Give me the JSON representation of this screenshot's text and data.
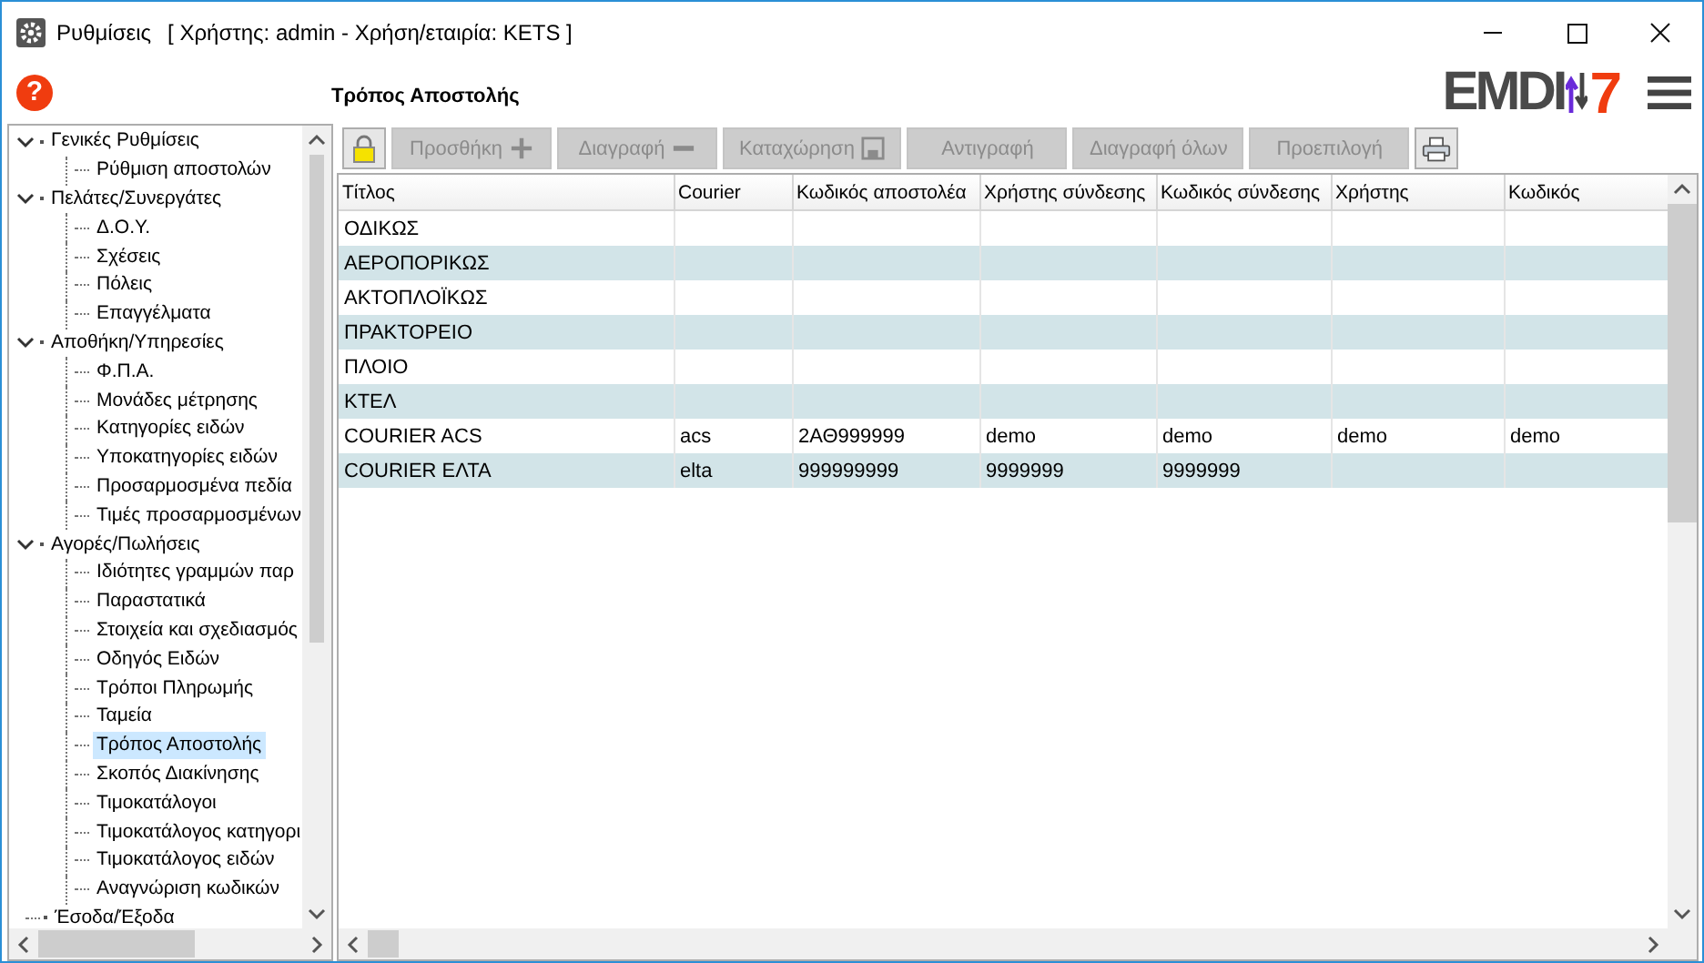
{
  "window": {
    "title": "Ρυθμίσεις",
    "subtitle": "[ Χρήστης: admin - Χρήση/εταιρία: KETS ]"
  },
  "header": {
    "help": "?",
    "page_title": "Τρόπος Αποστολής",
    "logo": {
      "text": "EMDI",
      "suffix": "7"
    }
  },
  "tree": [
    {
      "label": "Γενικές Ρυθμίσεις",
      "expanded": true,
      "children": [
        {
          "label": "Ρύθμιση αποστολών",
          "selected": false
        }
      ]
    },
    {
      "label": "Πελάτες/Συνεργάτες",
      "expanded": true,
      "children": [
        {
          "label": "Δ.Ο.Υ.",
          "selected": false
        },
        {
          "label": "Σχέσεις",
          "selected": false
        },
        {
          "label": "Πόλεις",
          "selected": false
        },
        {
          "label": "Επαγγέλματα",
          "selected": false
        }
      ]
    },
    {
      "label": "Αποθήκη/Υπηρεσίες",
      "expanded": true,
      "children": [
        {
          "label": "Φ.Π.Α.",
          "selected": false
        },
        {
          "label": "Μονάδες μέτρησης",
          "selected": false
        },
        {
          "label": "Κατηγορίες ειδών",
          "selected": false
        },
        {
          "label": "Υποκατηγορίες ειδών",
          "selected": false
        },
        {
          "label": "Προσαρμοσμένα πεδία",
          "selected": false
        },
        {
          "label": "Τιμές προσαρμοσμένων",
          "selected": false
        }
      ]
    },
    {
      "label": "Αγορές/Πωλήσεις",
      "expanded": true,
      "children": [
        {
          "label": "Ιδιότητες γραμμών παρ",
          "selected": false
        },
        {
          "label": "Παραστατικά",
          "selected": false
        },
        {
          "label": "Στοιχεία και σχεδιασμός",
          "selected": false
        },
        {
          "label": "Οδηγός Ειδών",
          "selected": false
        },
        {
          "label": "Τρόποι Πληρωμής",
          "selected": false
        },
        {
          "label": "Ταμεία",
          "selected": false
        },
        {
          "label": "Τρόπος Αποστολής",
          "selected": true
        },
        {
          "label": "Σκοπός Διακίνησης",
          "selected": false
        },
        {
          "label": "Τιμοκατάλογοι",
          "selected": false
        },
        {
          "label": "Τιμοκατάλογος κατηγορι",
          "selected": false
        },
        {
          "label": "Τιμοκατάλογος ειδών",
          "selected": false
        },
        {
          "label": "Αναγνώριση κωδικών",
          "selected": false
        }
      ]
    },
    {
      "label": "Έσοδα/Έξοδα",
      "selected": false
    }
  ],
  "toolbar": [
    {
      "kind": "lock",
      "disabled": false
    },
    {
      "kind": "add",
      "label": "Προσθήκη",
      "disabled": true
    },
    {
      "kind": "remove",
      "label": "Διαγραφή",
      "disabled": true
    },
    {
      "kind": "save",
      "label": "Καταχώρηση",
      "disabled": true
    },
    {
      "kind": "text",
      "label": "Αντιγραφή",
      "disabled": true
    },
    {
      "kind": "text",
      "label": "Διαγραφή όλων",
      "disabled": true
    },
    {
      "kind": "text",
      "label": "Προεπιλογή",
      "disabled": true
    },
    {
      "kind": "print",
      "disabled": false
    }
  ],
  "table": {
    "columns": [
      "Τίτλος",
      "Courier",
      "Κωδικός αποστολέα",
      "Χρήστης σύνδεσης",
      "Κωδικός σύνδεσης",
      "Χρήστης",
      "Κωδικός"
    ],
    "rows": [
      [
        "ΟΔΙΚΩΣ",
        "",
        "",
        "",
        "",
        "",
        ""
      ],
      [
        "ΑΕΡΟΠΟΡΙΚΩΣ",
        "",
        "",
        "",
        "",
        "",
        ""
      ],
      [
        "ΑΚΤΟΠΛΟΪΚΩΣ",
        "",
        "",
        "",
        "",
        "",
        ""
      ],
      [
        "ΠΡΑΚΤΟΡΕΙΟ",
        "",
        "",
        "",
        "",
        "",
        ""
      ],
      [
        "ΠΛΟΙΟ",
        "",
        "",
        "",
        "",
        "",
        ""
      ],
      [
        "ΚΤΕΛ",
        "",
        "",
        "",
        "",
        "",
        ""
      ],
      [
        "COURIER ACS",
        "acs",
        "2ΑΘ999999",
        "demo",
        "demo",
        "demo",
        "demo"
      ],
      [
        "COURIER ΕΛΤΑ",
        "elta",
        "999999999",
        "9999999",
        "9999999",
        "",
        ""
      ]
    ]
  }
}
